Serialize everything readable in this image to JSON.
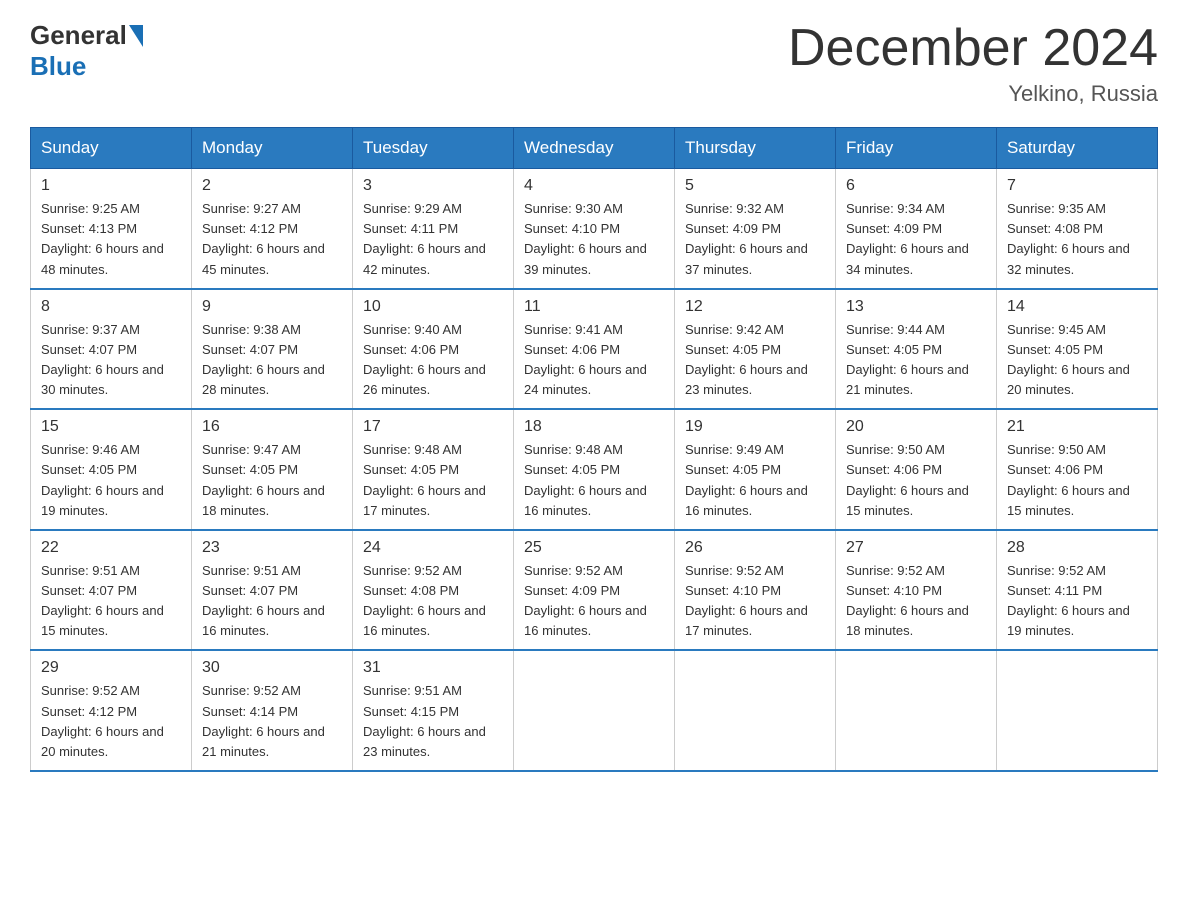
{
  "header": {
    "logo_general": "General",
    "logo_blue": "Blue",
    "title": "December 2024",
    "location": "Yelkino, Russia"
  },
  "days_of_week": [
    "Sunday",
    "Monday",
    "Tuesday",
    "Wednesday",
    "Thursday",
    "Friday",
    "Saturday"
  ],
  "weeks": [
    [
      {
        "num": "1",
        "sunrise": "9:25 AM",
        "sunset": "4:13 PM",
        "daylight": "6 hours and 48 minutes."
      },
      {
        "num": "2",
        "sunrise": "9:27 AM",
        "sunset": "4:12 PM",
        "daylight": "6 hours and 45 minutes."
      },
      {
        "num": "3",
        "sunrise": "9:29 AM",
        "sunset": "4:11 PM",
        "daylight": "6 hours and 42 minutes."
      },
      {
        "num": "4",
        "sunrise": "9:30 AM",
        "sunset": "4:10 PM",
        "daylight": "6 hours and 39 minutes."
      },
      {
        "num": "5",
        "sunrise": "9:32 AM",
        "sunset": "4:09 PM",
        "daylight": "6 hours and 37 minutes."
      },
      {
        "num": "6",
        "sunrise": "9:34 AM",
        "sunset": "4:09 PM",
        "daylight": "6 hours and 34 minutes."
      },
      {
        "num": "7",
        "sunrise": "9:35 AM",
        "sunset": "4:08 PM",
        "daylight": "6 hours and 32 minutes."
      }
    ],
    [
      {
        "num": "8",
        "sunrise": "9:37 AM",
        "sunset": "4:07 PM",
        "daylight": "6 hours and 30 minutes."
      },
      {
        "num": "9",
        "sunrise": "9:38 AM",
        "sunset": "4:07 PM",
        "daylight": "6 hours and 28 minutes."
      },
      {
        "num": "10",
        "sunrise": "9:40 AM",
        "sunset": "4:06 PM",
        "daylight": "6 hours and 26 minutes."
      },
      {
        "num": "11",
        "sunrise": "9:41 AM",
        "sunset": "4:06 PM",
        "daylight": "6 hours and 24 minutes."
      },
      {
        "num": "12",
        "sunrise": "9:42 AM",
        "sunset": "4:05 PM",
        "daylight": "6 hours and 23 minutes."
      },
      {
        "num": "13",
        "sunrise": "9:44 AM",
        "sunset": "4:05 PM",
        "daylight": "6 hours and 21 minutes."
      },
      {
        "num": "14",
        "sunrise": "9:45 AM",
        "sunset": "4:05 PM",
        "daylight": "6 hours and 20 minutes."
      }
    ],
    [
      {
        "num": "15",
        "sunrise": "9:46 AM",
        "sunset": "4:05 PM",
        "daylight": "6 hours and 19 minutes."
      },
      {
        "num": "16",
        "sunrise": "9:47 AM",
        "sunset": "4:05 PM",
        "daylight": "6 hours and 18 minutes."
      },
      {
        "num": "17",
        "sunrise": "9:48 AM",
        "sunset": "4:05 PM",
        "daylight": "6 hours and 17 minutes."
      },
      {
        "num": "18",
        "sunrise": "9:48 AM",
        "sunset": "4:05 PM",
        "daylight": "6 hours and 16 minutes."
      },
      {
        "num": "19",
        "sunrise": "9:49 AM",
        "sunset": "4:05 PM",
        "daylight": "6 hours and 16 minutes."
      },
      {
        "num": "20",
        "sunrise": "9:50 AM",
        "sunset": "4:06 PM",
        "daylight": "6 hours and 15 minutes."
      },
      {
        "num": "21",
        "sunrise": "9:50 AM",
        "sunset": "4:06 PM",
        "daylight": "6 hours and 15 minutes."
      }
    ],
    [
      {
        "num": "22",
        "sunrise": "9:51 AM",
        "sunset": "4:07 PM",
        "daylight": "6 hours and 15 minutes."
      },
      {
        "num": "23",
        "sunrise": "9:51 AM",
        "sunset": "4:07 PM",
        "daylight": "6 hours and 16 minutes."
      },
      {
        "num": "24",
        "sunrise": "9:52 AM",
        "sunset": "4:08 PM",
        "daylight": "6 hours and 16 minutes."
      },
      {
        "num": "25",
        "sunrise": "9:52 AM",
        "sunset": "4:09 PM",
        "daylight": "6 hours and 16 minutes."
      },
      {
        "num": "26",
        "sunrise": "9:52 AM",
        "sunset": "4:10 PM",
        "daylight": "6 hours and 17 minutes."
      },
      {
        "num": "27",
        "sunrise": "9:52 AM",
        "sunset": "4:10 PM",
        "daylight": "6 hours and 18 minutes."
      },
      {
        "num": "28",
        "sunrise": "9:52 AM",
        "sunset": "4:11 PM",
        "daylight": "6 hours and 19 minutes."
      }
    ],
    [
      {
        "num": "29",
        "sunrise": "9:52 AM",
        "sunset": "4:12 PM",
        "daylight": "6 hours and 20 minutes."
      },
      {
        "num": "30",
        "sunrise": "9:52 AM",
        "sunset": "4:14 PM",
        "daylight": "6 hours and 21 minutes."
      },
      {
        "num": "31",
        "sunrise": "9:51 AM",
        "sunset": "4:15 PM",
        "daylight": "6 hours and 23 minutes."
      },
      null,
      null,
      null,
      null
    ]
  ]
}
